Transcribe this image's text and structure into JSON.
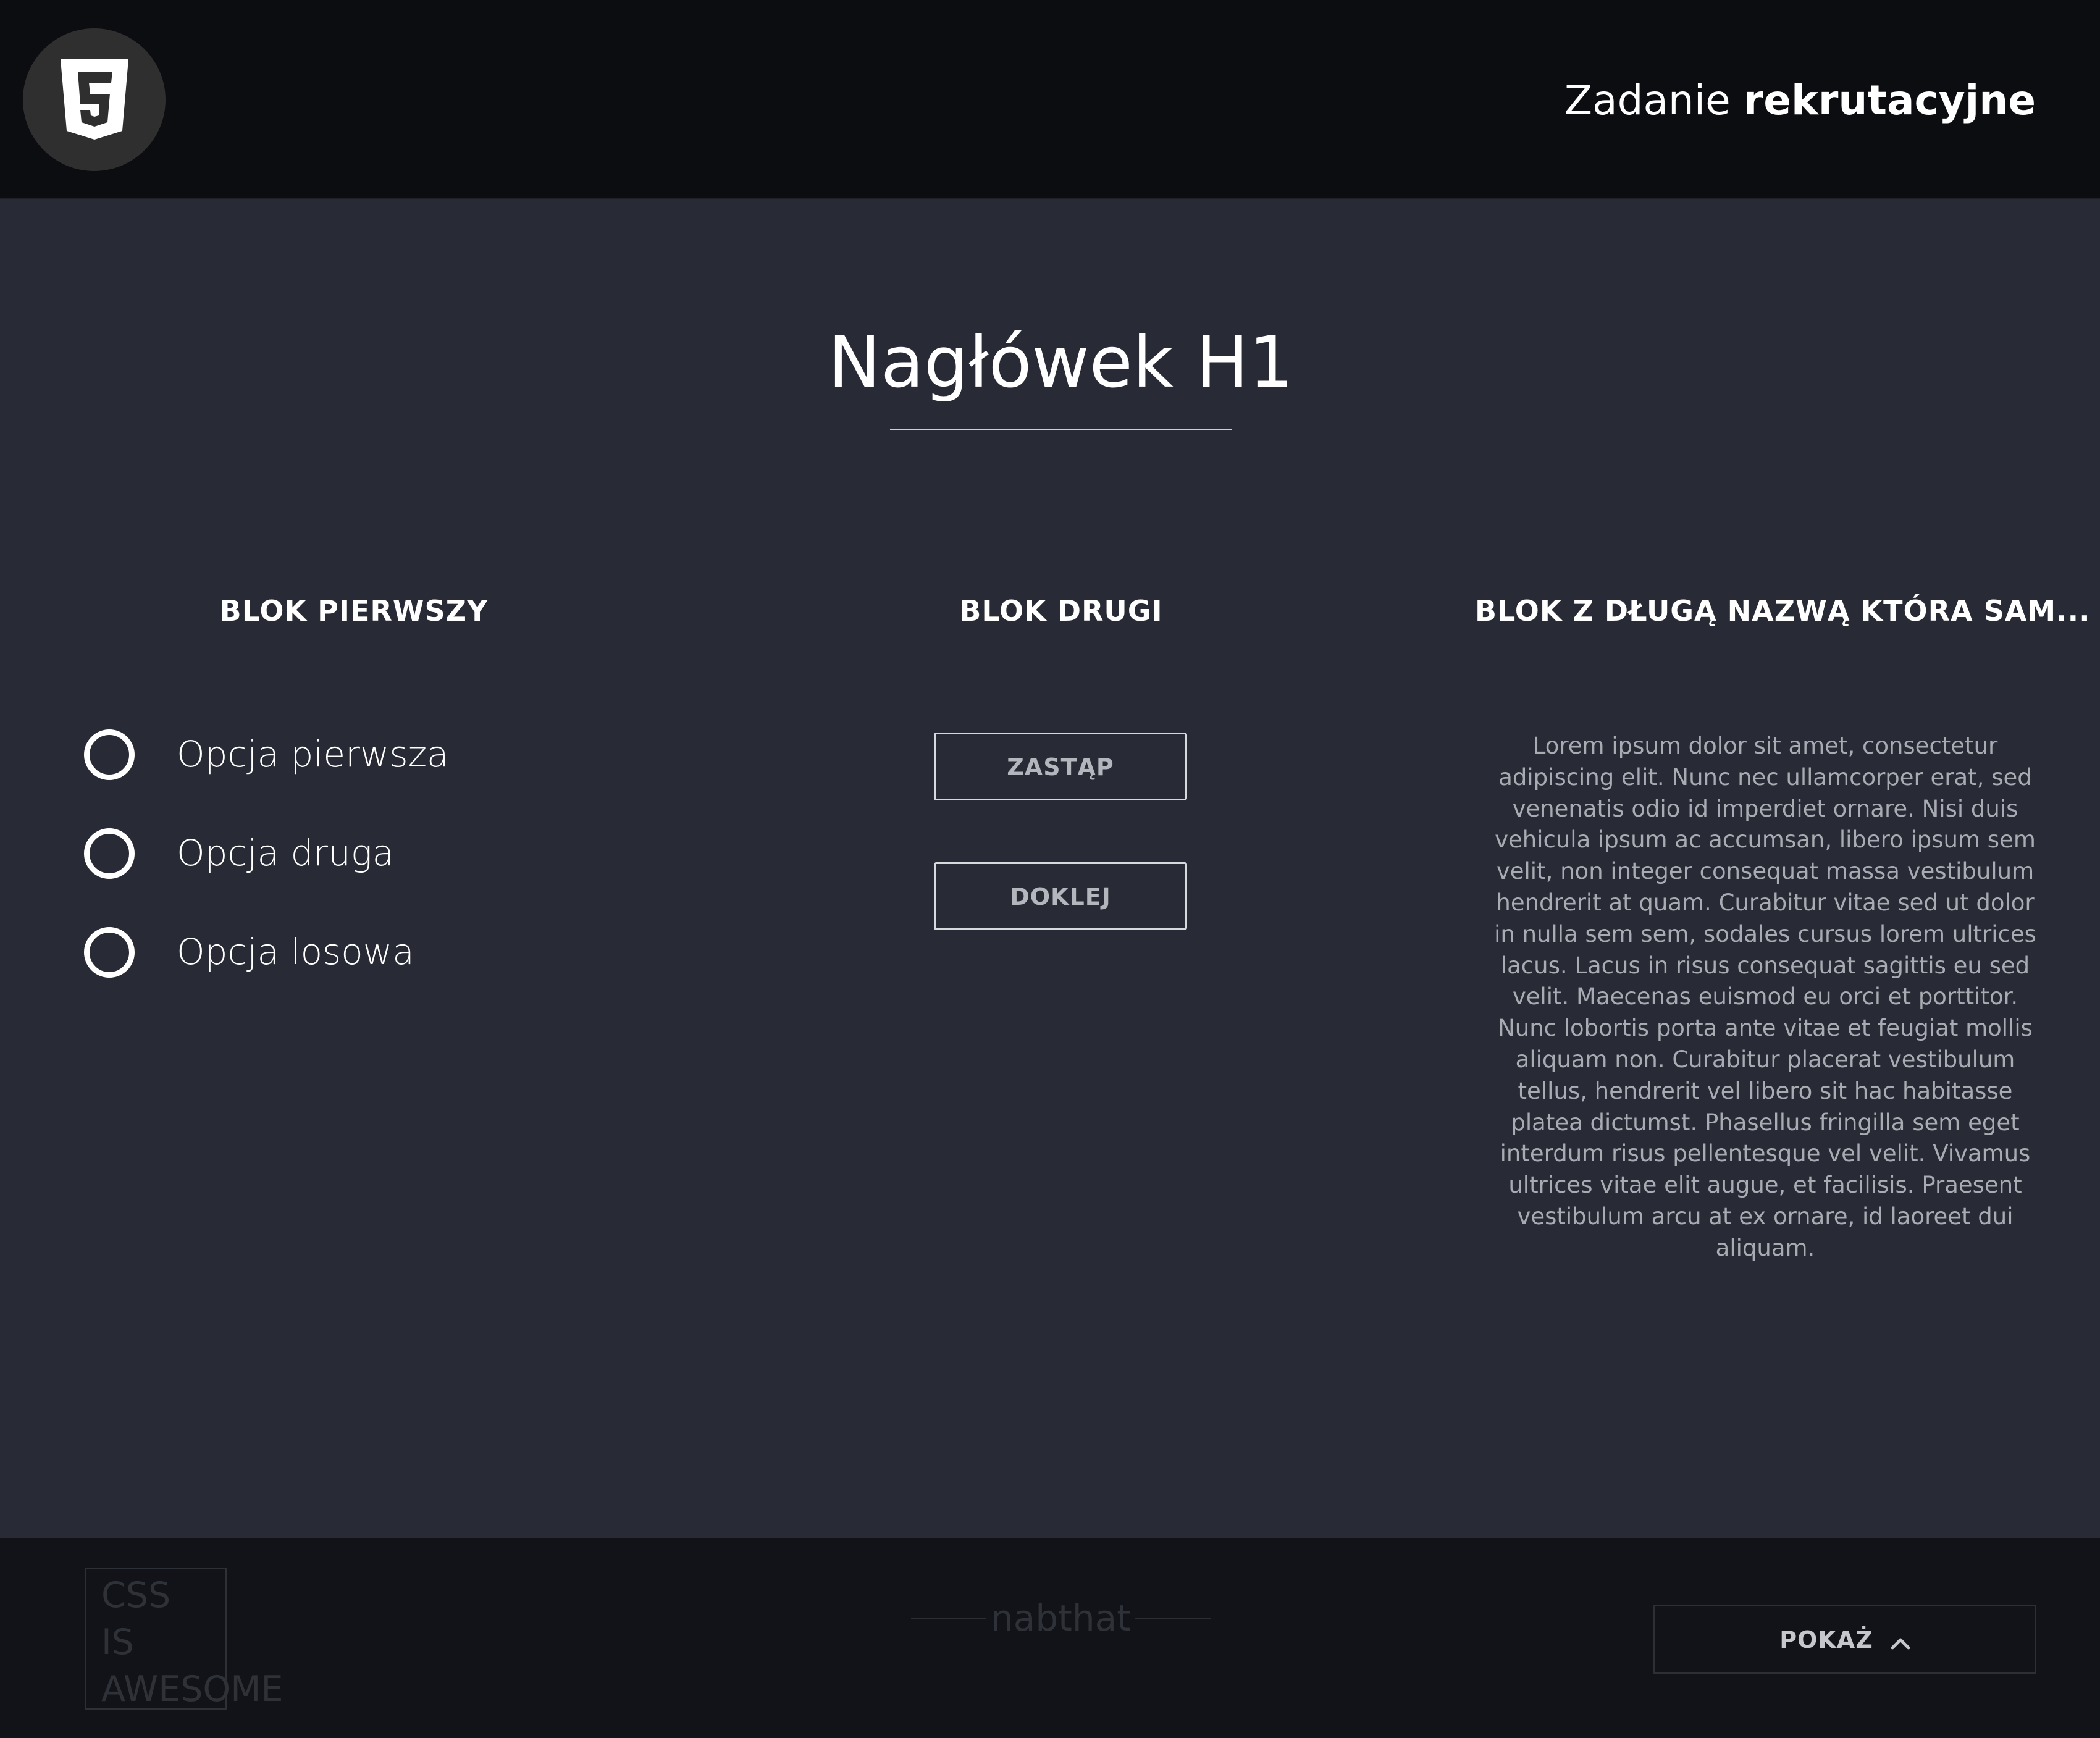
{
  "header": {
    "logo_icon": "html5-shield-icon",
    "title_regular": "Zadanie ",
    "title_bold": "rekrutacyjne"
  },
  "main": {
    "heading": "Nagłówek H1",
    "blocks": [
      {
        "title": "BLOK PIERWSZY",
        "options": [
          "Opcja pierwsza",
          "Opcja druga",
          "Opcja losowa"
        ]
      },
      {
        "title": "BLOK DRUGI",
        "buttons": [
          "ZASTĄP",
          "DOKLEJ"
        ]
      },
      {
        "title": "BLOK Z DŁUGĄ NAZWĄ KTÓRA SAM...",
        "text": "Lorem ipsum dolor sit amet, consectetur adipiscing elit. Nunc nec ullamcorper erat, sed venenatis odio id imperdiet ornare. Nisi duis vehicula ipsum ac accumsan, libero ipsum sem velit, non integer consequat massa vestibulum hendrerit at quam. Curabitur vitae sed ut dolor in nulla sem sem, sodales cursus lorem ultrices lacus. Lacus in risus consequat sagittis eu sed velit. Maecenas euismod eu orci et porttitor. Nunc lobortis porta ante vitae et feugiat mollis aliquam non. Curabitur placerat vestibulum tellus, hendrerit vel libero sit hac habitasse platea dictumst. Phasellus fringilla sem eget interdum risus pellentesque vel velit. Vivamus ultrices vitae elit augue, et facilisis. Praesent vestibulum arcu at ex ornare, id laoreet dui aliquam."
      }
    ]
  },
  "footer": {
    "css_badge": [
      "CSS",
      "IS",
      "AWESOME"
    ],
    "signature": "nabthat",
    "show_button": "POKAŻ",
    "show_button_icon": "chevron-up-icon"
  },
  "colors": {
    "header_bg": "#0c0d11",
    "main_bg": "#282b35",
    "footer_bg": "#111318",
    "text": "#ffffff",
    "muted_text": "#a9abb2"
  }
}
